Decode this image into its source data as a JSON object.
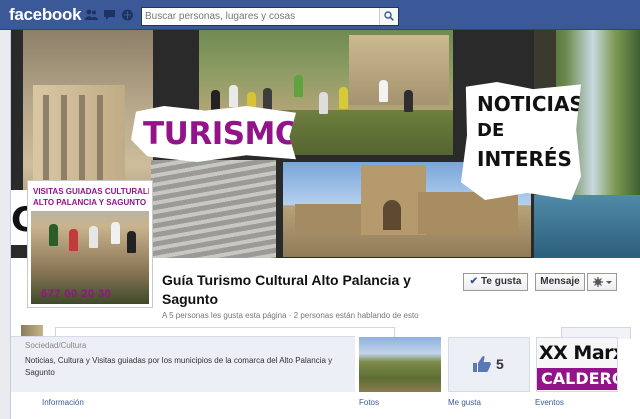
{
  "topbar": {
    "logo": "facebook",
    "search_placeholder": "Buscar personas, lugares y cosas",
    "icons": [
      "friend-requests-icon",
      "messages-icon",
      "notifications-icon",
      "search-icon"
    ]
  },
  "cover": {
    "title_main": "TURISMO",
    "title_side_1": "NOTICIAS",
    "title_side_2": "DE",
    "title_side_3": "INTERÉS",
    "left_letter": "C",
    "accent_color": "#93148a"
  },
  "profile": {
    "line1": "VISITAS GUIADAS CULTURALES",
    "line2": "ALTO PALANCIA Y SAGUNTO",
    "phone": "677 00 20 30"
  },
  "page": {
    "name": "Guía Turismo Cultural Alto Palancia y Sagunto",
    "stats": "A 5 personas les gusta esta página · 2 personas están hablando de esto"
  },
  "actions": {
    "like_label": "Te gusta",
    "message_label": "Mensaje"
  },
  "about": {
    "category": "Sociedad/Cultura",
    "description": "Noticias, Cultura y Visitas guiadas por los municipios de la comarca del Alto Palancia y Sagunto"
  },
  "apps": {
    "likes_count": "5",
    "events_line1": "XX Marxa",
    "events_line2": "CALDERO",
    "labels": [
      "Información",
      "Fotos",
      "Me gusta",
      "Eventos"
    ]
  }
}
